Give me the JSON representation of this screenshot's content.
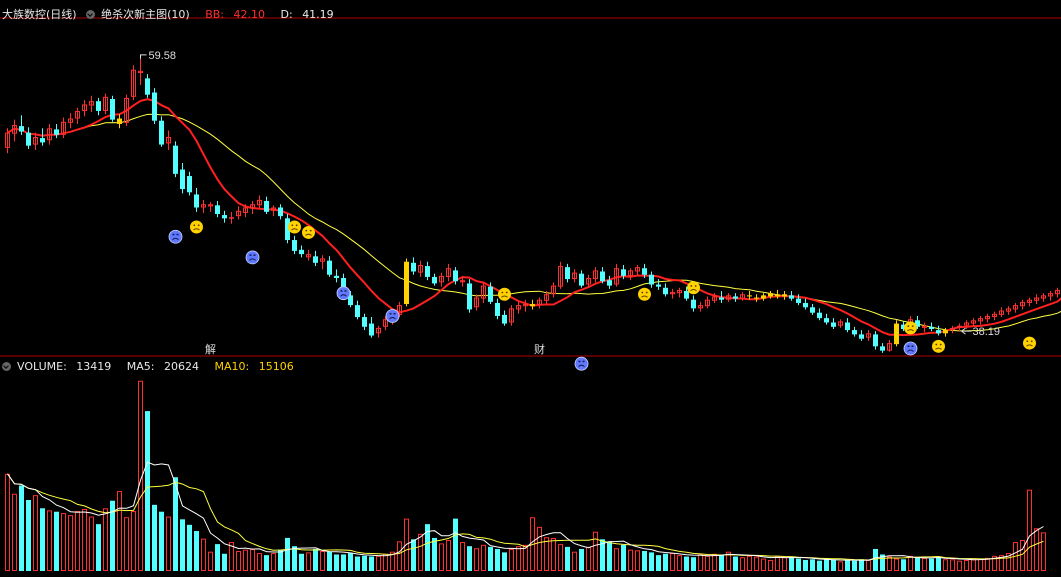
{
  "header": {
    "stock_name": "大族数控(日线)",
    "indicator_name": "绝杀次新主图(10)",
    "bb_label": "BB:",
    "bb_value": "42.10",
    "d_label": "D:",
    "d_value": "41.19"
  },
  "volume_header": {
    "volume_label": "VOLUME:",
    "volume_value": "13419",
    "ma5_label": "MA5:",
    "ma5_value": "20624",
    "ma10_label": "MA10:",
    "ma10_value": "15106"
  },
  "colors": {
    "up": "#ff3030",
    "down": "#54ffff",
    "signal": "#ffd200",
    "ma_fast": "#ff2020",
    "ma_slow": "#ffff40",
    "ma5_vol": "#ffffff",
    "ma10_vol": "#ffff40",
    "divider": "#b00000",
    "sad_face": "#5e78ff",
    "frown_face": "#ffd200"
  },
  "chart_data": {
    "type": "candlestick",
    "price_axis": {
      "min": 33.5,
      "max": 63
    },
    "volume_axis": {
      "min": 0,
      "max": 28000
    },
    "annotations": [
      {
        "label": "59.58",
        "candle": 19,
        "role": "high"
      },
      {
        "label": "38.19",
        "candle": 136,
        "role": "low"
      },
      {
        "label": "解",
        "candle": 29,
        "role": "event-marker"
      },
      {
        "label": "财",
        "candle": 76,
        "role": "event-marker"
      }
    ],
    "candles": [
      [
        51.4,
        53.2,
        50.9,
        52.8,
        "up"
      ],
      [
        52.7,
        54.0,
        52.0,
        53.5,
        "up"
      ],
      [
        53.4,
        54.4,
        52.6,
        52.9,
        "down"
      ],
      [
        52.8,
        53.3,
        51.3,
        51.6,
        "down"
      ],
      [
        51.7,
        52.8,
        51.2,
        52.4,
        "up"
      ],
      [
        52.3,
        53.2,
        51.6,
        51.9,
        "down"
      ],
      [
        52.1,
        53.6,
        51.7,
        53.2,
        "up"
      ],
      [
        53.1,
        53.6,
        52.3,
        52.6,
        "down"
      ],
      [
        52.6,
        54.2,
        52.3,
        53.8,
        "up"
      ],
      [
        53.7,
        54.6,
        53.2,
        54.1,
        "up"
      ],
      [
        54.1,
        55.1,
        53.6,
        54.8,
        "up"
      ],
      [
        54.8,
        55.8,
        54.3,
        55.4,
        "up"
      ],
      [
        55.3,
        56.2,
        54.7,
        55.7,
        "up"
      ],
      [
        55.7,
        56.0,
        54.4,
        54.8,
        "down"
      ],
      [
        54.8,
        56.4,
        54.5,
        56.1,
        "up"
      ],
      [
        55.9,
        56.2,
        53.8,
        54.0,
        "down"
      ],
      [
        54.1,
        54.5,
        53.2,
        53.6,
        "signal"
      ],
      [
        53.7,
        56.3,
        53.4,
        56.0,
        "up"
      ],
      [
        56.1,
        59.0,
        55.8,
        58.6,
        "up"
      ],
      [
        58.5,
        59.6,
        57.2,
        58.3,
        "up"
      ],
      [
        57.8,
        58.2,
        56.0,
        56.3,
        "down"
      ],
      [
        56.5,
        56.9,
        53.6,
        53.9,
        "down"
      ],
      [
        53.9,
        54.3,
        51.5,
        51.7,
        "down"
      ],
      [
        52.4,
        53.0,
        51.2,
        51.8,
        "up"
      ],
      [
        51.6,
        52.0,
        48.7,
        49.0,
        "down"
      ],
      [
        49.4,
        50.0,
        47.2,
        47.6,
        "down"
      ],
      [
        48.8,
        49.2,
        47.0,
        47.3,
        "down"
      ],
      [
        47.1,
        47.7,
        45.5,
        45.9,
        "down"
      ],
      [
        45.9,
        46.6,
        45.4,
        46.2,
        "up"
      ],
      [
        46.0,
        46.4,
        45.5,
        46.2,
        "up"
      ],
      [
        46.1,
        46.5,
        45.0,
        45.3,
        "down"
      ],
      [
        45.2,
        45.6,
        44.5,
        44.9,
        "down"
      ],
      [
        44.9,
        45.5,
        44.4,
        45.0,
        "up"
      ],
      [
        45.1,
        46.0,
        44.8,
        45.6,
        "up"
      ],
      [
        45.4,
        46.2,
        45.0,
        45.9,
        "up"
      ],
      [
        45.8,
        46.5,
        45.3,
        46.2,
        "up"
      ],
      [
        46.1,
        47.0,
        45.8,
        46.6,
        "up"
      ],
      [
        46.5,
        46.9,
        45.3,
        45.5,
        "down"
      ],
      [
        45.6,
        46.1,
        45.1,
        45.9,
        "up"
      ],
      [
        45.9,
        46.2,
        44.8,
        45.1,
        "down"
      ],
      [
        44.9,
        45.3,
        42.6,
        42.9,
        "down"
      ],
      [
        42.9,
        43.3,
        41.6,
        41.9,
        "down"
      ],
      [
        42.0,
        42.4,
        41.3,
        41.6,
        "down"
      ],
      [
        41.6,
        42.0,
        41.0,
        41.3,
        "up"
      ],
      [
        41.4,
        41.9,
        40.5,
        40.8,
        "down"
      ],
      [
        40.9,
        41.5,
        40.2,
        41.2,
        "up"
      ],
      [
        41.0,
        41.4,
        39.5,
        39.7,
        "down"
      ],
      [
        39.6,
        40.2,
        39.0,
        39.4,
        "down"
      ],
      [
        39.4,
        39.8,
        37.6,
        37.9,
        "down"
      ],
      [
        37.8,
        38.2,
        36.7,
        36.9,
        "down"
      ],
      [
        36.9,
        37.3,
        35.6,
        35.8,
        "down"
      ],
      [
        35.8,
        36.1,
        34.6,
        34.9,
        "down"
      ],
      [
        35.2,
        35.8,
        33.9,
        34.1,
        "down"
      ],
      [
        34.3,
        35.0,
        33.9,
        34.8,
        "up"
      ],
      [
        34.9,
        35.9,
        34.6,
        35.6,
        "up"
      ],
      [
        35.5,
        36.4,
        35.1,
        36.1,
        "up"
      ],
      [
        36.0,
        37.2,
        35.8,
        36.9,
        "up"
      ],
      [
        37.0,
        41.2,
        36.8,
        40.9,
        "signal"
      ],
      [
        40.8,
        41.3,
        39.7,
        40.0,
        "down"
      ],
      [
        39.9,
        41.0,
        39.5,
        40.6,
        "up"
      ],
      [
        40.5,
        40.9,
        39.2,
        39.5,
        "down"
      ],
      [
        39.5,
        39.8,
        38.7,
        38.9,
        "down"
      ],
      [
        39.0,
        39.9,
        38.6,
        39.6,
        "up"
      ],
      [
        39.5,
        40.7,
        39.1,
        40.3,
        "up"
      ],
      [
        40.1,
        40.4,
        38.8,
        39.1,
        "down"
      ],
      [
        39.2,
        39.6,
        38.6,
        39.0,
        "up"
      ],
      [
        38.9,
        39.3,
        36.2,
        36.5,
        "down"
      ],
      [
        36.7,
        37.9,
        36.4,
        37.6,
        "up"
      ],
      [
        37.5,
        38.9,
        37.1,
        38.7,
        "up"
      ],
      [
        38.6,
        39.0,
        37.0,
        37.2,
        "down"
      ],
      [
        37.1,
        37.5,
        35.6,
        35.9,
        "down"
      ],
      [
        36.0,
        36.4,
        35.0,
        35.2,
        "down"
      ],
      [
        35.3,
        36.9,
        35.0,
        36.6,
        "up"
      ],
      [
        36.5,
        37.2,
        36.1,
        36.9,
        "up"
      ],
      [
        36.8,
        37.4,
        36.3,
        37.0,
        "up"
      ],
      [
        37.0,
        37.4,
        36.5,
        36.8,
        "signal"
      ],
      [
        36.9,
        37.6,
        36.6,
        37.4,
        "up"
      ],
      [
        37.3,
        38.2,
        37.0,
        37.9,
        "up"
      ],
      [
        37.9,
        39.0,
        37.6,
        38.7,
        "up"
      ],
      [
        38.6,
        40.9,
        38.4,
        40.5,
        "up"
      ],
      [
        40.4,
        40.7,
        39.0,
        39.3,
        "down"
      ],
      [
        39.3,
        40.2,
        39.0,
        39.9,
        "up"
      ],
      [
        39.8,
        40.1,
        38.5,
        38.7,
        "down"
      ],
      [
        38.8,
        39.7,
        38.5,
        39.4,
        "up"
      ],
      [
        39.3,
        40.4,
        39.0,
        40.1,
        "up"
      ],
      [
        40.0,
        40.4,
        38.9,
        39.1,
        "down"
      ],
      [
        39.2,
        39.6,
        38.4,
        38.7,
        "down"
      ],
      [
        38.8,
        40.7,
        38.6,
        40.3,
        "up"
      ],
      [
        40.2,
        40.6,
        39.3,
        39.6,
        "down"
      ],
      [
        39.6,
        40.3,
        39.2,
        40.1,
        "up"
      ],
      [
        40.0,
        40.6,
        39.6,
        40.4,
        "up"
      ],
      [
        40.3,
        40.7,
        39.4,
        39.7,
        "down"
      ],
      [
        39.7,
        40.0,
        38.5,
        38.8,
        "down"
      ],
      [
        38.8,
        39.3,
        38.3,
        38.6,
        "down"
      ],
      [
        38.5,
        38.9,
        37.7,
        37.9,
        "down"
      ],
      [
        37.9,
        38.4,
        37.5,
        38.1,
        "up"
      ],
      [
        38.0,
        38.5,
        37.6,
        38.3,
        "up"
      ],
      [
        38.2,
        38.6,
        37.3,
        37.5,
        "down"
      ],
      [
        37.4,
        37.8,
        36.3,
        36.6,
        "down"
      ],
      [
        36.6,
        37.2,
        36.3,
        36.9,
        "up"
      ],
      [
        36.8,
        37.7,
        36.6,
        37.4,
        "up"
      ],
      [
        37.3,
        38.0,
        37.1,
        37.7,
        "up"
      ],
      [
        37.6,
        38.2,
        37.1,
        37.4,
        "down"
      ],
      [
        37.4,
        38.0,
        37.2,
        37.8,
        "up"
      ],
      [
        37.7,
        38.0,
        37.2,
        37.5,
        "down"
      ],
      [
        37.5,
        38.1,
        37.3,
        37.9,
        "up"
      ],
      [
        37.8,
        38.2,
        37.4,
        37.7,
        "signal"
      ],
      [
        37.6,
        37.9,
        37.2,
        37.5,
        "signal"
      ],
      [
        37.5,
        38.0,
        37.3,
        37.8,
        "signal"
      ],
      [
        37.7,
        38.2,
        37.5,
        38.0,
        "signal"
      ],
      [
        37.9,
        38.3,
        37.5,
        37.7,
        "signal"
      ],
      [
        37.7,
        38.2,
        37.4,
        37.9,
        "signal"
      ],
      [
        37.8,
        38.2,
        37.3,
        37.5,
        "down"
      ],
      [
        37.5,
        37.9,
        36.9,
        37.1,
        "down"
      ],
      [
        37.1,
        37.5,
        36.5,
        36.7,
        "down"
      ],
      [
        36.7,
        37.0,
        36.0,
        36.2,
        "down"
      ],
      [
        36.2,
        36.6,
        35.5,
        35.7,
        "down"
      ],
      [
        35.7,
        36.1,
        35.1,
        35.3,
        "down"
      ],
      [
        35.3,
        35.7,
        34.7,
        34.9,
        "down"
      ],
      [
        35.0,
        35.6,
        34.8,
        35.4,
        "up"
      ],
      [
        35.3,
        35.7,
        34.4,
        34.6,
        "down"
      ],
      [
        34.6,
        34.9,
        34.0,
        34.2,
        "down"
      ],
      [
        34.2,
        34.6,
        33.6,
        33.8,
        "down"
      ],
      [
        33.9,
        34.6,
        33.6,
        34.3,
        "up"
      ],
      [
        34.2,
        34.5,
        32.8,
        33.1,
        "down"
      ],
      [
        33.1,
        33.4,
        32.5,
        32.7,
        "down"
      ],
      [
        32.7,
        33.7,
        32.6,
        33.4,
        "up"
      ],
      [
        33.3,
        35.5,
        33.1,
        35.2,
        "signal"
      ],
      [
        35.1,
        35.4,
        34.5,
        34.7,
        "down"
      ],
      [
        34.7,
        35.9,
        34.4,
        35.6,
        "up"
      ],
      [
        35.5,
        35.9,
        34.7,
        34.9,
        "down"
      ],
      [
        34.8,
        35.3,
        34.4,
        35.0,
        "up"
      ],
      [
        34.9,
        35.3,
        34.5,
        34.7,
        "down"
      ],
      [
        34.6,
        35.0,
        34.1,
        34.3,
        "down"
      ],
      [
        34.3,
        34.8,
        34.0,
        34.6,
        "signal"
      ],
      [
        34.6,
        35.0,
        34.3,
        34.8,
        "up"
      ],
      [
        34.8,
        35.2,
        34.5,
        35.0,
        "up"
      ],
      [
        35.0,
        35.5,
        34.7,
        35.3,
        "up"
      ],
      [
        35.2,
        35.7,
        34.9,
        35.5,
        "up"
      ],
      [
        35.4,
        35.9,
        35.1,
        35.7,
        "up"
      ],
      [
        35.6,
        36.1,
        35.3,
        35.9,
        "up"
      ],
      [
        35.8,
        36.3,
        35.5,
        36.1,
        "up"
      ],
      [
        36.0,
        36.7,
        35.8,
        36.4,
        "up"
      ],
      [
        36.3,
        36.8,
        36.0,
        36.6,
        "up"
      ],
      [
        36.5,
        37.1,
        36.2,
        36.9,
        "up"
      ],
      [
        36.8,
        37.4,
        36.5,
        37.2,
        "up"
      ],
      [
        37.1,
        37.6,
        36.8,
        37.4,
        "up"
      ],
      [
        37.3,
        37.9,
        37.0,
        37.6,
        "up"
      ],
      [
        37.5,
        38.0,
        37.2,
        37.8,
        "up"
      ],
      [
        37.7,
        38.2,
        37.3,
        38.0,
        "up"
      ],
      [
        37.9,
        38.5,
        37.6,
        38.3,
        "up"
      ],
      [
        38.2,
        41.9,
        38.0,
        41.5,
        "up"
      ],
      [
        41.2,
        41.6,
        40.2,
        40.5,
        "down"
      ],
      [
        40.4,
        41.3,
        40.1,
        41.0,
        "up"
      ],
      [
        41.0,
        41.6,
        40.7,
        41.2,
        "down"
      ]
    ],
    "face_markers": [
      {
        "candle": 24,
        "type": "sad",
        "price": 43.2
      },
      {
        "candle": 27,
        "type": "frown",
        "price": 44.1
      },
      {
        "candle": 35,
        "type": "sad",
        "price": 41.3
      },
      {
        "candle": 41,
        "type": "frown",
        "price": 44.1
      },
      {
        "candle": 43,
        "type": "frown",
        "price": 43.6
      },
      {
        "candle": 48,
        "type": "sad",
        "price": 38.0
      },
      {
        "candle": 55,
        "type": "sad",
        "price": 35.9
      },
      {
        "candle": 71,
        "type": "frown",
        "price": 37.9
      },
      {
        "candle": 82,
        "type": "sad",
        "price": 31.5
      },
      {
        "candle": 91,
        "type": "frown",
        "price": 37.9
      },
      {
        "candle": 98,
        "type": "frown",
        "price": 38.5
      },
      {
        "candle": 129,
        "type": "frown",
        "price": 34.8
      },
      {
        "candle": 129,
        "type": "sad",
        "price": 32.9
      },
      {
        "candle": 133,
        "type": "frown",
        "price": 33.1
      },
      {
        "candle": 146,
        "type": "frown",
        "price": 33.4
      }
    ],
    "volume": [
      14100,
      11200,
      12400,
      10300,
      11000,
      9100,
      8800,
      8600,
      8400,
      8100,
      8700,
      9000,
      7900,
      6800,
      9100,
      10200,
      11600,
      7800,
      8700,
      27600,
      23200,
      9600,
      8600,
      7900,
      13600,
      7500,
      6700,
      5800,
      4700,
      2800,
      3900,
      2500,
      4200,
      2900,
      3100,
      3200,
      2600,
      2300,
      2600,
      3100,
      4800,
      3600,
      2500,
      2700,
      3200,
      2900,
      2800,
      2400,
      2400,
      2600,
      2100,
      2200,
      2100,
      2200,
      2500,
      2800,
      4300,
      7600,
      4600,
      5400,
      6800,
      4800,
      4000,
      4500,
      7600,
      4200,
      3600,
      3300,
      3800,
      3500,
      3200,
      2700,
      3200,
      3600,
      3800,
      7800,
      6400,
      4900,
      4800,
      3900,
      3500,
      2800,
      3200,
      3500,
      5700,
      4600,
      4300,
      3300,
      3800,
      3100,
      3000,
      2900,
      2700,
      2300,
      2500,
      2600,
      2300,
      2100,
      2000,
      2400,
      2200,
      2500,
      2300,
      2800,
      2100,
      2000,
      2200,
      2100,
      1800,
      1600,
      2200,
      2000,
      2100,
      1800,
      1600,
      1700,
      1500,
      1800,
      1600,
      1400,
      1600,
      1500,
      1700,
      1600,
      3200,
      2400,
      2100,
      1800,
      1700,
      2200,
      1900,
      1900,
      1800,
      2000,
      1700,
      1700,
      1500,
      1600,
      1700,
      1800,
      1900,
      2200,
      2300,
      2600,
      4200,
      4500,
      11800,
      6200,
      5600
    ],
    "ma_lines": {
      "fast_period": 10,
      "slow_period": 20
    }
  }
}
